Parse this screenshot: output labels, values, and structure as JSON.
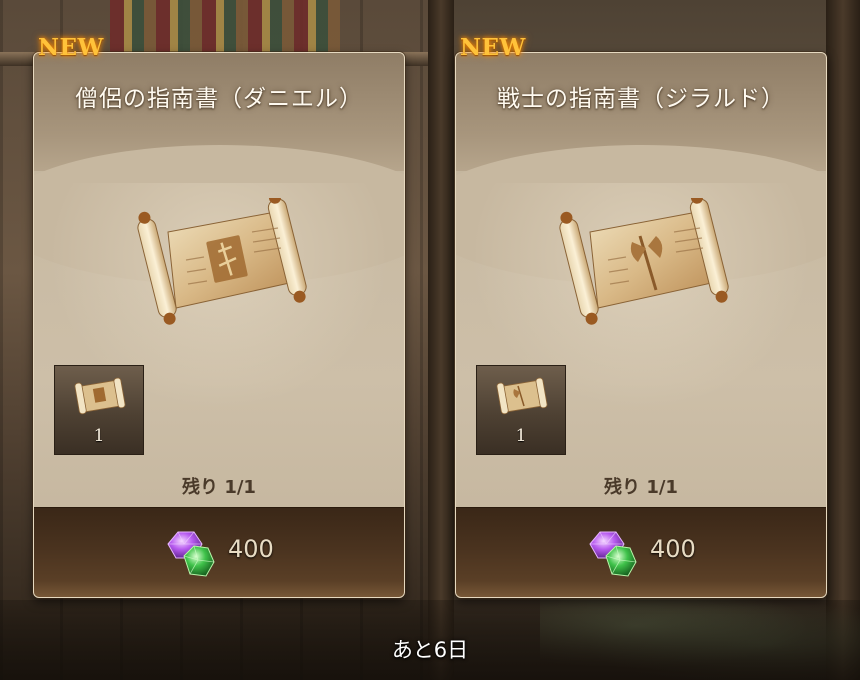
{
  "offers": [
    {
      "badge": "NEW",
      "title": "僧侶の指南書（ダニエル）",
      "item_icon": "cleric-scroll-icon",
      "item_quantity": "1",
      "remaining": "残り 1/1",
      "price": "400",
      "currency_icon": "gem-icon"
    },
    {
      "badge": "NEW",
      "title": "戦士の指南書（ジラルド）",
      "item_icon": "warrior-scroll-icon",
      "item_quantity": "1",
      "remaining": "残り 1/1",
      "price": "400",
      "currency_icon": "gem-icon"
    }
  ],
  "footer": {
    "time_left": "あと6日"
  },
  "colors": {
    "badge": "#ffc23a",
    "card_bg": "#c8baa3",
    "price_bar": "#4a331f",
    "gem_purple": "#b85cf0",
    "gem_green": "#3fc24a"
  }
}
